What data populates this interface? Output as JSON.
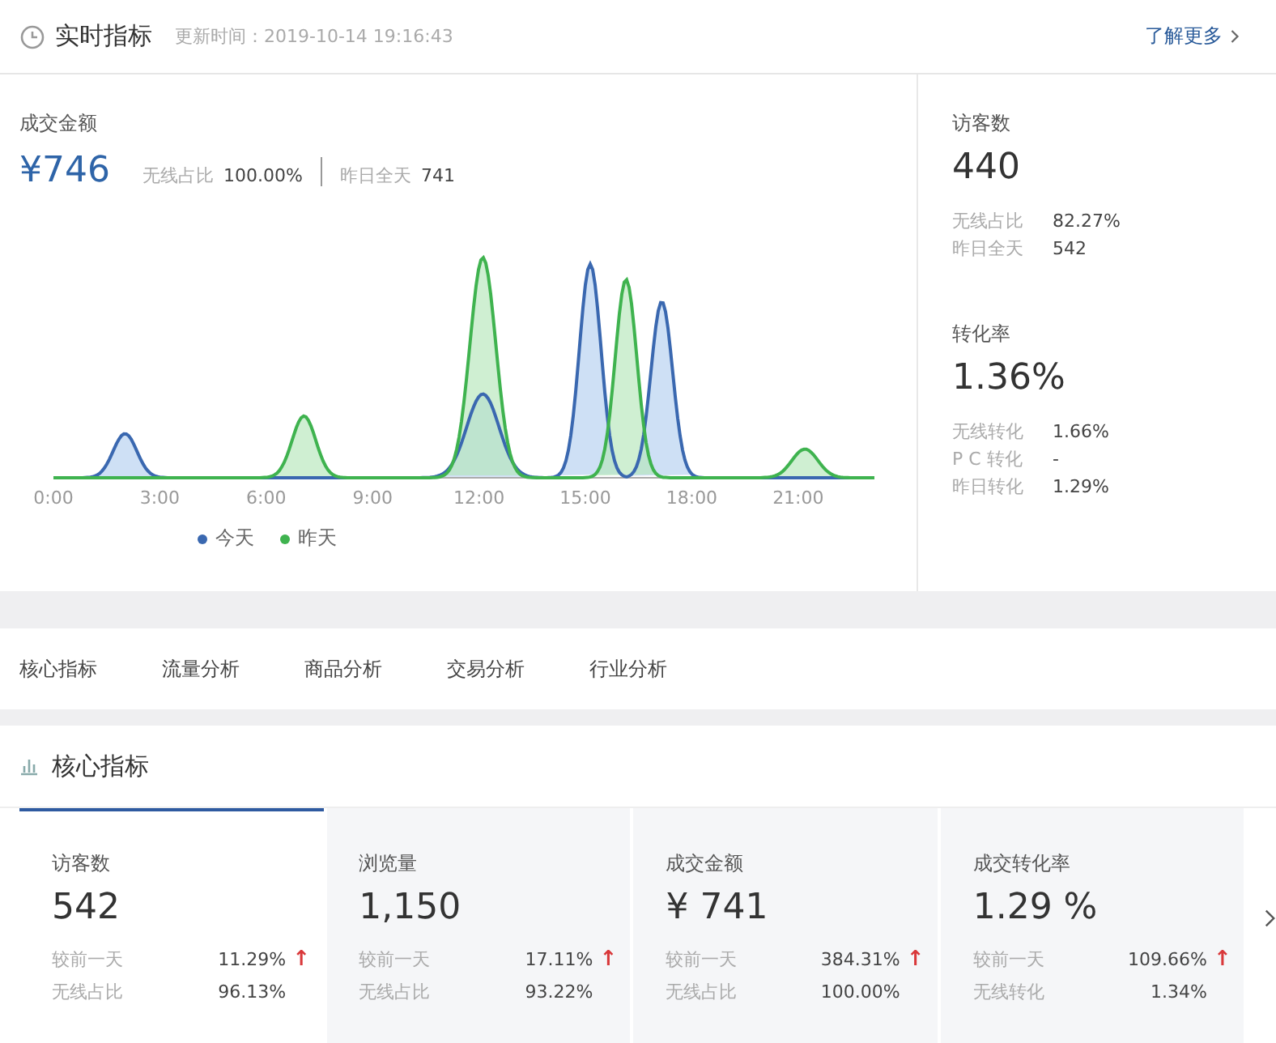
{
  "header": {
    "title": "实时指标",
    "updated": "更新时间：2019-10-14 19:16:43",
    "link": "了解更多"
  },
  "main_metric": {
    "label": "成交金额",
    "value": "¥746",
    "stats": [
      {
        "label": "无线占比",
        "value": "100.00%"
      },
      {
        "label": "昨日全天",
        "value": "741"
      }
    ]
  },
  "chart": {
    "x_labels": [
      "0:00",
      "3:00",
      "6:00",
      "9:00",
      "12:00",
      "15:00",
      "18:00",
      "21:00"
    ],
    "legend": [
      {
        "label": "今天",
        "color": "#3a68b0"
      },
      {
        "label": "昨天",
        "color": "#3fb34f"
      }
    ]
  },
  "side_metrics": [
    {
      "label": "访客数",
      "value": "440",
      "stats": [
        {
          "label": "无线占比",
          "value": "82.27%"
        },
        {
          "label": "昨日全天",
          "value": "542"
        }
      ]
    },
    {
      "label": "转化率",
      "value": "1.36%",
      "stats": [
        {
          "label": "无线转化",
          "value": "1.66%"
        },
        {
          "label": "P C 转化",
          "value": "-"
        },
        {
          "label": "昨日转化",
          "value": "1.29%"
        }
      ]
    }
  ],
  "tabs": [
    {
      "label": "核心指标",
      "selected": false
    },
    {
      "label": "流量分析",
      "selected": false
    },
    {
      "label": "商品分析",
      "selected": false
    },
    {
      "label": "交易分析",
      "selected": false
    },
    {
      "label": "行业分析",
      "selected": false
    }
  ],
  "core": {
    "title": "核心指标",
    "cards": [
      {
        "label": "访客数",
        "value": "542",
        "selected": true,
        "rows": [
          {
            "label": "较前一天",
            "value": "11.29%",
            "arrow": "↑"
          },
          {
            "label": "无线占比",
            "value": "96.13%"
          }
        ]
      },
      {
        "label": "浏览量",
        "value": "1,150",
        "selected": false,
        "rows": [
          {
            "label": "较前一天",
            "value": "17.11%",
            "arrow": "↑"
          },
          {
            "label": "无线占比",
            "value": "93.22%"
          }
        ]
      },
      {
        "label": "成交金额",
        "value": "¥ 741",
        "selected": false,
        "rows": [
          {
            "label": "较前一天",
            "value": "384.31%",
            "arrow": "↑"
          },
          {
            "label": "无线占比",
            "value": "100.00%"
          }
        ]
      },
      {
        "label": "成交转化率",
        "value": "1.29 %",
        "selected": false,
        "rows": [
          {
            "label": "较前一天",
            "value": "109.66%",
            "arrow": "↑"
          },
          {
            "label": "无线转化",
            "value": "1.34%"
          }
        ]
      }
    ]
  }
}
